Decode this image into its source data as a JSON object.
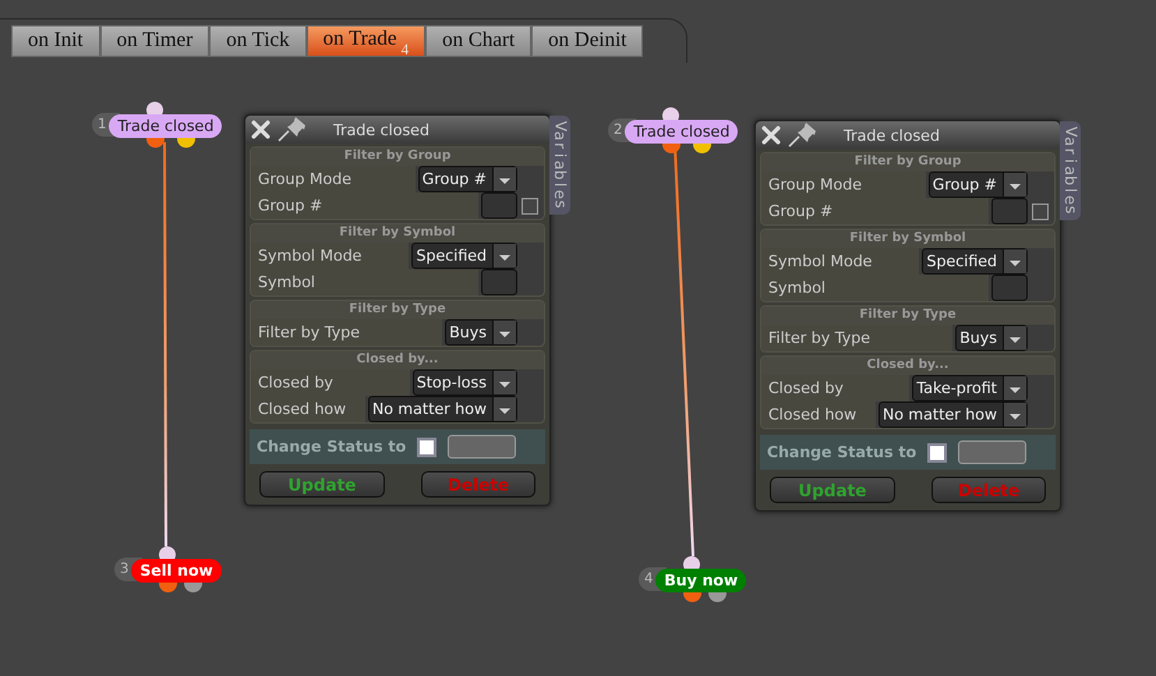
{
  "tabs": [
    {
      "label": "on Init",
      "selected": false
    },
    {
      "label": "on Timer",
      "selected": false
    },
    {
      "label": "on Tick",
      "selected": false
    },
    {
      "label": "on Trade",
      "selected": true,
      "badge": "4"
    },
    {
      "label": "on Chart",
      "selected": false
    },
    {
      "label": "on Deinit",
      "selected": false
    }
  ],
  "chains": [
    {
      "trigger": {
        "number": "1",
        "label": "Trade closed",
        "color": "#d9a8f5"
      },
      "panel": {
        "title": "Trade closed",
        "side_tab": "Variables",
        "sections": [
          {
            "heading": "Filter by Group",
            "rows": [
              {
                "label": "Group Mode",
                "kind": "dropdown",
                "value": "Group #"
              },
              {
                "label": "Group #",
                "kind": "input",
                "checked": false
              }
            ]
          },
          {
            "heading": "Filter by Symbol",
            "rows": [
              {
                "label": "Symbol Mode",
                "kind": "dropdown",
                "value": "Specified"
              },
              {
                "label": "Symbol",
                "kind": "input"
              }
            ]
          },
          {
            "heading": "Filter by Type",
            "rows": [
              {
                "label": "Filter by Type",
                "kind": "dropdown",
                "value": "Buys"
              }
            ]
          },
          {
            "heading": "Closed by...",
            "rows": [
              {
                "label": "Closed by",
                "kind": "dropdown",
                "value": "Stop-loss"
              },
              {
                "label": "Closed how",
                "kind": "dropdown",
                "value": "No matter how"
              }
            ]
          }
        ],
        "status": {
          "label": "Change Status to",
          "checked": false
        },
        "buttons": [
          {
            "label": "Update",
            "kind": "update"
          },
          {
            "label": "Delete",
            "kind": "delete"
          }
        ]
      },
      "action": {
        "number": "3",
        "label": "Sell now",
        "color": "#ff0000"
      }
    },
    {
      "trigger": {
        "number": "2",
        "label": "Trade closed",
        "color": "#d9a8f5"
      },
      "panel": {
        "title": "Trade closed",
        "side_tab": "Variables",
        "sections": [
          {
            "heading": "Filter by Group",
            "rows": [
              {
                "label": "Group Mode",
                "kind": "dropdown",
                "value": "Group #"
              },
              {
                "label": "Group #",
                "kind": "input",
                "checked": false
              }
            ]
          },
          {
            "heading": "Filter by Symbol",
            "rows": [
              {
                "label": "Symbol Mode",
                "kind": "dropdown",
                "value": "Specified"
              },
              {
                "label": "Symbol",
                "kind": "input"
              }
            ]
          },
          {
            "heading": "Filter by Type",
            "rows": [
              {
                "label": "Filter by Type",
                "kind": "dropdown",
                "value": "Buys"
              }
            ]
          },
          {
            "heading": "Closed by...",
            "rows": [
              {
                "label": "Closed by",
                "kind": "dropdown",
                "value": "Take-profit"
              },
              {
                "label": "Closed how",
                "kind": "dropdown",
                "value": "No matter how"
              }
            ]
          }
        ],
        "status": {
          "label": "Change Status to",
          "checked": false
        },
        "buttons": [
          {
            "label": "Update",
            "kind": "update"
          },
          {
            "label": "Delete",
            "kind": "delete"
          }
        ]
      },
      "action": {
        "number": "4",
        "label": "Buy now",
        "color": "#008000"
      }
    }
  ]
}
